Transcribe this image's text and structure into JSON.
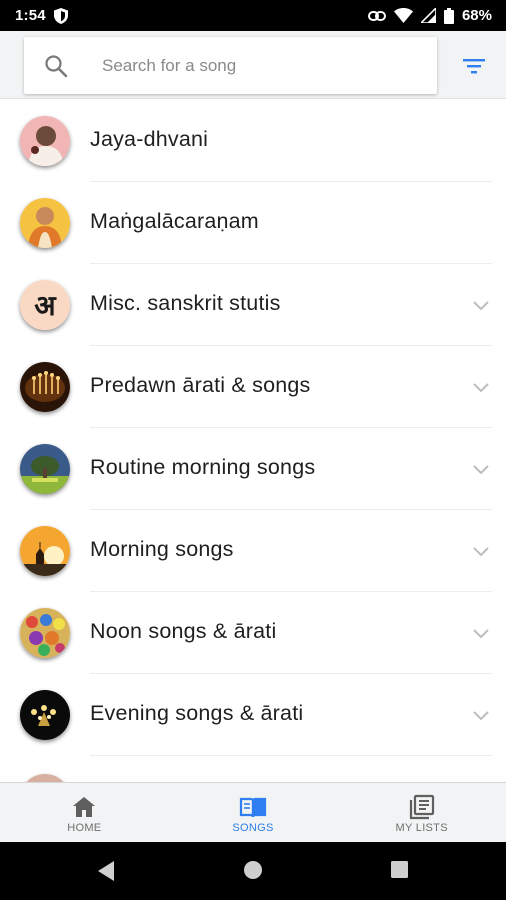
{
  "status_bar": {
    "time": "1:54",
    "battery": "68%",
    "icons": [
      "shield-icon",
      "link-icon",
      "wifi-icon",
      "cell-signal-icon",
      "battery-icon"
    ]
  },
  "search": {
    "placeholder": "Search for a song",
    "value": ""
  },
  "colors": {
    "accent": "#2f7ff0",
    "text": "#1f1f1f",
    "header_bg": "#f1f3f4"
  },
  "songs": [
    {
      "label": "Jaya-dhvani",
      "has_chevron": false,
      "avatar": "photo-portrait-red"
    },
    {
      "label": "Maṅgalācaraṇam",
      "has_chevron": false,
      "avatar": "photo-portrait-saffron"
    },
    {
      "label": "Misc. sanskrit stutis",
      "has_chevron": true,
      "avatar": "devanagari-a-icon"
    },
    {
      "label": "Predawn ārati & songs",
      "has_chevron": true,
      "avatar": "candles-photo"
    },
    {
      "label": "Routine morning songs",
      "has_chevron": true,
      "avatar": "tree-photo"
    },
    {
      "label": "Morning songs",
      "has_chevron": true,
      "avatar": "sunrise-temple-photo"
    },
    {
      "label": "Noon songs & ārati",
      "has_chevron": true,
      "avatar": "colorful-altar-photo"
    },
    {
      "label": "Evening songs & ārati",
      "has_chevron": true,
      "avatar": "lamp-photo"
    }
  ],
  "bottom_nav": {
    "home": "HOME",
    "songs": "SONGS",
    "my_lists": "MY LISTS",
    "active": "songs"
  }
}
